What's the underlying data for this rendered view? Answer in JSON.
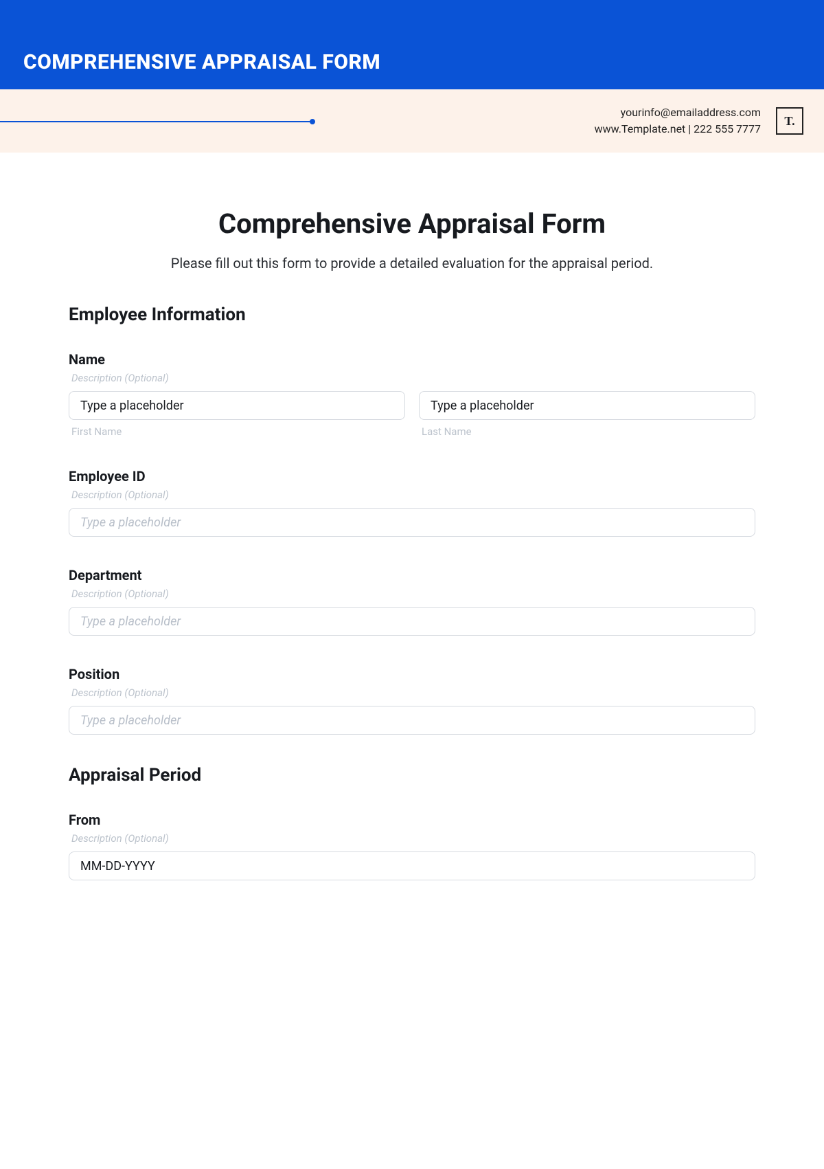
{
  "header": {
    "banner_title": "COMPREHENSIVE APPRAISAL FORM",
    "email": "yourinfo@emailaddress.com",
    "website_phone": "www.Template.net  |  222 555 7777",
    "logo": "T."
  },
  "form": {
    "title": "Comprehensive Appraisal Form",
    "description": "Please fill out this form to provide a detailed evaluation for the appraisal period."
  },
  "sections": {
    "employee": {
      "title": "Employee Information",
      "name": {
        "label": "Name",
        "hint": "Description (Optional)",
        "first_value": "Type a placeholder",
        "last_value": "Type a placeholder",
        "first_sub": "First Name",
        "last_sub": "Last Name"
      },
      "employee_id": {
        "label": "Employee ID",
        "hint": "Description (Optional)",
        "placeholder": "Type a placeholder"
      },
      "department": {
        "label": "Department",
        "hint": "Description (Optional)",
        "placeholder": "Type a placeholder"
      },
      "position": {
        "label": "Position",
        "hint": "Description (Optional)",
        "placeholder": "Type a placeholder"
      }
    },
    "period": {
      "title": "Appraisal Period",
      "from": {
        "label": "From",
        "hint": "Description (Optional)",
        "value": "MM-DD-YYYY"
      }
    }
  }
}
